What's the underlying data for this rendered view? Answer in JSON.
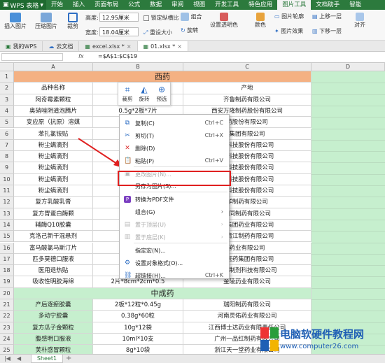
{
  "app": {
    "title": "WPS 表格"
  },
  "menu": [
    "开始",
    "插入",
    "页面布局",
    "公式",
    "数据",
    "审阅",
    "视图",
    "开发工具",
    "特色应用",
    "图片工具",
    "文档助手",
    "智能"
  ],
  "active_menu": "图片工具",
  "ribbon": {
    "insert_picture": "插入图片",
    "compress": "压缩图片",
    "crop": "裁剪",
    "height_label": "高度:",
    "height_value": "12.95厘米",
    "width_label": "宽度:",
    "width_value": "18.04厘米",
    "lock_ratio": "锁定纵横比",
    "reset_size": "重设大小",
    "combine": "组合",
    "rotate": "旋转",
    "align": "对齐",
    "transparent": "设置透明色",
    "color": "颜色",
    "effect": "图片效果",
    "border": "图片轮廓",
    "reset_picture": "重设图片",
    "top": "上移一层",
    "bottom": "下移一层",
    "align_right": "对齐"
  },
  "tabs": [
    {
      "label": "我的WPS"
    },
    {
      "label": "云文档"
    },
    {
      "label": "excel.xlsx *"
    },
    {
      "label": "01.xlsx *"
    }
  ],
  "formula": {
    "cell_ref": "",
    "fx": "fx",
    "value": "=$A$1:$C$19"
  },
  "columns": [
    "A",
    "B",
    "C",
    "D"
  ],
  "sheet": {
    "title_west": "西药",
    "header_name": "品种名称",
    "header_place": "产地",
    "title_chinese": "中成药",
    "rows_west": [
      {
        "n": "3",
        "name": "阿奇霉素颗粒",
        "spec": "",
        "place": "齐鲁制药有限公司"
      },
      {
        "n": "4",
        "name": "奥硝唑阴道泡腾片",
        "spec": "0.5g*2板*7片",
        "place": "西安万隆制药股份有限公司"
      },
      {
        "n": "5",
        "name": "变应原（抗原）溶媒",
        "spec": "",
        "place": "药股份有限公司"
      },
      {
        "n": "6",
        "name": "苯扎氯铵贴",
        "spec": "100",
        "place": "集团有限公司"
      },
      {
        "n": "7",
        "name": "粉尘螨滴剂",
        "spec": "(1",
        "place": "物科技股份有限公司"
      },
      {
        "n": "8",
        "name": "粉尘螨滴剂",
        "spec": "(2",
        "place": "物科技股份有限公司"
      },
      {
        "n": "9",
        "name": "粉尘螨滴剂",
        "spec": "(3",
        "place": "物科技股份有限公司"
      },
      {
        "n": "10",
        "name": "粉尘螨滴剂",
        "spec": "(4#",
        "place": "物科技股份有限公司"
      },
      {
        "n": "11",
        "name": "粉尘螨滴剂",
        "spec": "(5#",
        "place": "物科技股份有限公司"
      },
      {
        "n": "12",
        "name": "复方乳酸乳膏",
        "spec": "",
        "place": "洋制药有限公司"
      },
      {
        "n": "13",
        "name": "复方胃蛋白酶颗",
        "spec": "",
        "place": "大同制药有限公司"
      },
      {
        "n": "14",
        "name": "辅酶Q10胶囊",
        "spec": "",
        "place": "东集团药业有限公司"
      },
      {
        "n": "15",
        "name": "克洛己新干混悬剂",
        "spec": "",
        "place": "大清江制药有限公司"
      },
      {
        "n": "16",
        "name": "富马酸氯马斯汀片",
        "spec": "",
        "place": "药业有限公司"
      },
      {
        "n": "17",
        "name": "匹多莫德口服液",
        "spec": "",
        "place": "中医药集团有限公司"
      },
      {
        "n": "18",
        "name": "医用退热贴",
        "spec": "",
        "place": "外用制剂科技有限公司"
      },
      {
        "n": "19",
        "name": "吸收性明胶海绵",
        "spec": "2片*8cm*2cm*0.5",
        "place": "金陵药业有限公司"
      }
    ],
    "rows_chinese": [
      {
        "n": "21",
        "name": "产后逐瘀胶囊",
        "spec": "2板*12粒*0.45g",
        "place": "瑞阳制药有限公司"
      },
      {
        "n": "22",
        "name": "多动宁胶囊",
        "spec": "0.38g*60粒",
        "place": "河南灵佑药业有限公司"
      },
      {
        "n": "23",
        "name": "复方瓜子金颗粒",
        "spec": "10g*12袋",
        "place": "江西博士达药业有限责任公司"
      },
      {
        "n": "24",
        "name": "腹感明口服液",
        "spec": "10ml*10支",
        "place": "广州一品红制药有限公司"
      },
      {
        "n": "25",
        "name": "芙朴感冒颗粒",
        "spec": "8g*10袋",
        "place": "浙江天一堂药业有限公司"
      }
    ],
    "row_header_1": "1",
    "row_header_2": "2",
    "row_header_20": "20"
  },
  "pic_toolbar": {
    "crop": "裁剪",
    "rotate": "旋转",
    "preview": "预选"
  },
  "context_menu": [
    {
      "label": "复制(C)",
      "key": "Ctrl+C",
      "icon": "copy-icon",
      "disabled": false
    },
    {
      "label": "剪切(T)",
      "key": "Ctrl+X",
      "icon": "cut-icon",
      "disabled": false
    },
    {
      "label": "删除(D)",
      "key": "",
      "icon": "delete-icon",
      "disabled": false
    },
    {
      "label": "粘贴(P)",
      "key": "Ctrl+V",
      "icon": "paste-icon",
      "disabled": false
    },
    {
      "label": "更改图片(N)...",
      "key": "",
      "icon": "change-picture-icon",
      "disabled": true
    },
    {
      "label": "另存为图片(S)...",
      "key": "",
      "icon": "save-as-picture-icon",
      "disabled": false
    },
    {
      "label": "转换为PDF文件",
      "key": "",
      "icon": "pdf-icon",
      "disabled": false
    },
    {
      "label": "组合(G)",
      "key": "›",
      "icon": "group-icon",
      "disabled": false
    },
    {
      "label": "置于顶层(U)",
      "key": "›",
      "icon": "bring-front-icon",
      "disabled": true
    },
    {
      "label": "置于底层(K)",
      "key": "›",
      "icon": "send-back-icon",
      "disabled": true
    },
    {
      "label": "指定宏(N)...",
      "key": "",
      "icon": "macro-icon",
      "disabled": false
    },
    {
      "label": "设置对象格式(O)...",
      "key": "",
      "icon": "format-icon",
      "disabled": false
    },
    {
      "label": "超链接(H)...",
      "key": "Ctrl+K",
      "icon": "link-icon",
      "disabled": false
    }
  ],
  "sheet_tab": "Sheet1",
  "watermark": {
    "line1": "电脑软硬件教程网",
    "line2": "www.computer26.com"
  },
  "colors": {
    "brand": "#2c7a3d",
    "header_fill": "#f4b183",
    "green_cells": "#c6efce",
    "highlight": "#e02020"
  }
}
